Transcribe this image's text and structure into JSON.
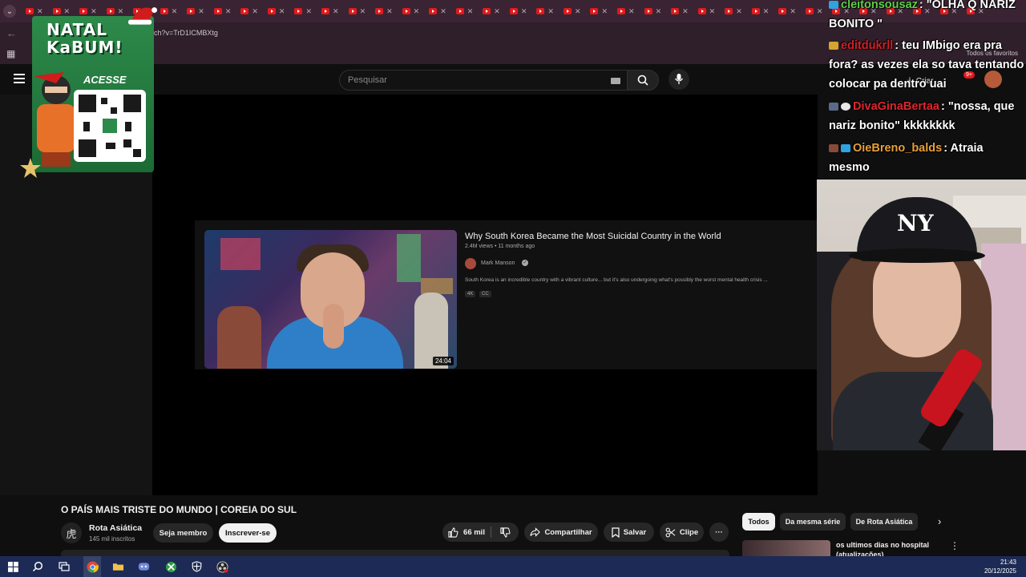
{
  "browser": {
    "url_fragment": "ch?v=TrD1ICMBXtg",
    "bookmarks_label": "Todos os favoritos",
    "tab_count": 36
  },
  "youtube_header": {
    "search_placeholder": "Pesquisar",
    "create_label": "Criar",
    "notifications_badge": "9+"
  },
  "ad": {
    "title_line1": "NATAL",
    "title_line2": "KaBUM!",
    "cta": "ACESSE"
  },
  "inner_result": {
    "title": "Why South Korea Became the Most Suicidal Country in the World",
    "meta": "2.4M views • 11 months ago",
    "channel": "Mark Manson",
    "description": "South Korea is an incredible country with a vibrant culture... but it's also undergoing what's possibly the worst mental health crisis ...",
    "tags": [
      "4K",
      "CC"
    ],
    "duration": "24:04"
  },
  "chat": {
    "messages": [
      {
        "user": "cleitonsousaz",
        "text": ": \"OLHA Q NARIZ BONITO \"",
        "user_color": "#5ecf4a",
        "badges": [
          "#2ea3e0"
        ]
      },
      {
        "user": "editdukrll",
        "text": ": teu IMbigo era pra fora? as vezes ela so tava tentando colocar pa dentro uai",
        "user_color": "#d0202a",
        "badges": [
          "#d6a431"
        ]
      },
      {
        "user": "DivaGinaBertaa",
        "text": ": \"nossa, que nariz bonito\" kkkkkkkk",
        "user_color": "#e0242c",
        "badges": [
          "#5a6a8a",
          "#e8e8e8"
        ]
      },
      {
        "user": "OieBreno_balds",
        "text": ": Atraia mesmo",
        "user_color": "#e8a13a",
        "badges": [
          "#8a4a3a",
          "#2ea3e0"
        ]
      }
    ]
  },
  "webcam": {
    "cap_logo": "NY"
  },
  "video": {
    "title": "O PAÍS MAIS TRISTE DO MUNDO | COREIA DO SUL",
    "channel_name": "Rota Asiática",
    "channel_avatar_glyph": "虎",
    "subscribers": "145 mil inscritos",
    "join_label": "Seja membro",
    "subscribe_label": "Inscrever-se",
    "likes": "66 mil",
    "share_label": "Compartilhar",
    "save_label": "Salvar",
    "clip_label": "Clipe",
    "more_label": "···"
  },
  "sidebar_chips": {
    "all": "Todos",
    "series": "Da mesma série",
    "channel": "De Rota Asiática"
  },
  "recommendation": {
    "title": "os ultimos dias no hospital (atualizações)"
  },
  "taskbar": {
    "time": "21:43",
    "date": "20/12/2025"
  },
  "colors": {
    "youtube_red": "#e21a1a",
    "chrome_frame": "#2e1f2a",
    "taskbar": "#1c2a55",
    "ad_green": "#2d8a4a"
  }
}
